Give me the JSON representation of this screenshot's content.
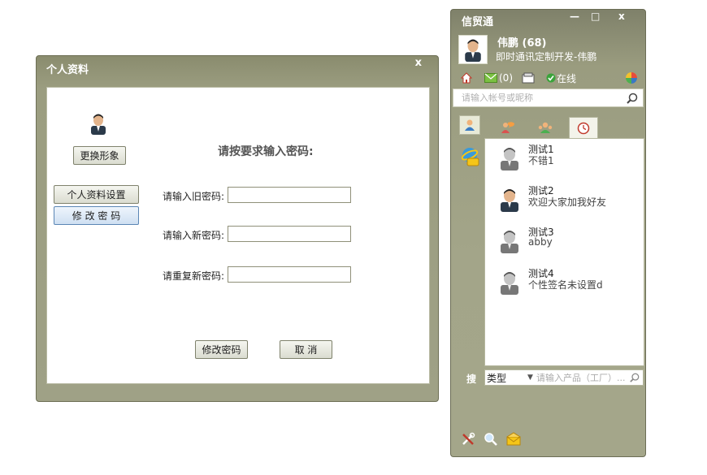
{
  "profile_dialog": {
    "title": "个人资料",
    "close": "x",
    "change_avatar_button": "更换形象",
    "nav": {
      "profile_settings": "个人资料设置",
      "change_password": "修 改 密 码"
    },
    "heading": "请按要求输入密码:",
    "fields": [
      {
        "label": "请输入旧密码:",
        "value": ""
      },
      {
        "label": "请输入新密码:",
        "value": ""
      },
      {
        "label": "请重复新密码:",
        "value": ""
      }
    ],
    "submit_button": "修改密码",
    "cancel_button": "取 消"
  },
  "messenger": {
    "title": "信贸通",
    "minimize": "—",
    "maximize": "□",
    "close": "x",
    "user": {
      "name": "伟鹏 (68)",
      "signature": "即时通讯定制开发-伟鹏"
    },
    "mail_count": "(0)",
    "status": "在线",
    "search_placeholder": "请输入帐号或昵称",
    "contacts": [
      {
        "name": "测试1",
        "signature": "不错1",
        "avatar": "gray-person-icon"
      },
      {
        "name": "测试2",
        "signature": "欢迎大家加我好友",
        "avatar": "man-portrait-icon"
      },
      {
        "name": "测试3",
        "signature": "abby",
        "avatar": "gray-person-icon"
      },
      {
        "name": "测试4",
        "signature": "个性签名未设置d",
        "avatar": "gray-person-icon"
      }
    ],
    "search_label": "搜",
    "type_select": "类型",
    "product_placeholder": "请输入产品（工厂）..."
  },
  "colors": {
    "chrome": "#9a9c7f",
    "chrome_dark": "#7f816a",
    "button_active_border": "#5b86b5"
  }
}
